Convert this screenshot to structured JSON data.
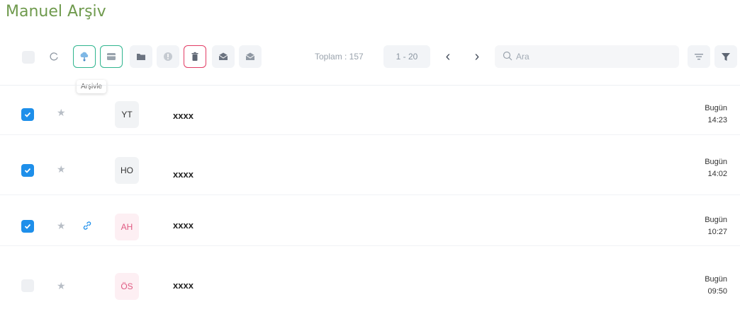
{
  "page": {
    "title": "Manuel Arşiv"
  },
  "toolbar": {
    "total": "Toplam : 157",
    "range": "1 - 20",
    "prev_icon": "‹",
    "next_icon": "›",
    "search_placeholder": "Ara",
    "tooltip": "Arşivle"
  },
  "colors": {
    "title": "#6f9a4d",
    "checkbox": "#1e8fea",
    "archive_border": "#2fb58e",
    "delete_border": "#e23c64",
    "avatar_pink_text": "#e05a82"
  },
  "rows": [
    {
      "checked": true,
      "initials": "YT",
      "subject": "xxxx",
      "day": "Bugün",
      "time": "14:23"
    },
    {
      "checked": true,
      "initials": "HO",
      "subject": "xxxx",
      "day": "Bugün",
      "time": "14:02"
    },
    {
      "checked": true,
      "initials": "AH",
      "subject": "xxxx",
      "day": "Bugün",
      "time": "10:27"
    },
    {
      "checked": false,
      "initials": "ÖS",
      "subject": "xxxx",
      "day": "Bugün",
      "time": "09:50"
    }
  ]
}
